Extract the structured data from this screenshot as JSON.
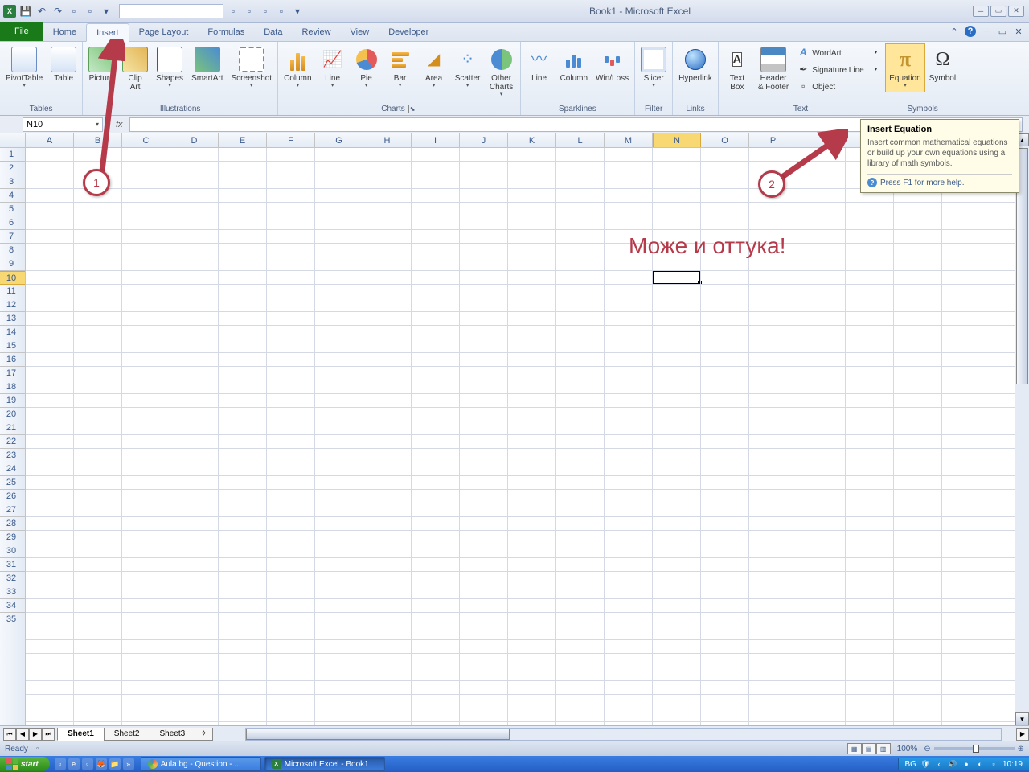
{
  "app_title": "Book1 - Microsoft Excel",
  "tabs": {
    "file": "File",
    "home": "Home",
    "insert": "Insert",
    "pagelayout": "Page Layout",
    "formulas": "Formulas",
    "data": "Data",
    "review": "Review",
    "view": "View",
    "developer": "Developer"
  },
  "ribbon": {
    "tables": {
      "label": "Tables",
      "pivottable": "PivotTable",
      "table": "Table"
    },
    "illustrations": {
      "label": "Illustrations",
      "picture": "Picture",
      "clipart": "Clip\nArt",
      "shapes": "Shapes",
      "smartart": "SmartArt",
      "screenshot": "Screenshot"
    },
    "charts": {
      "label": "Charts",
      "column": "Column",
      "line": "Line",
      "pie": "Pie",
      "bar": "Bar",
      "area": "Area",
      "scatter": "Scatter",
      "other": "Other\nCharts"
    },
    "sparklines": {
      "label": "Sparklines",
      "line": "Line",
      "column": "Column",
      "winloss": "Win/Loss"
    },
    "filter": {
      "label": "Filter",
      "slicer": "Slicer"
    },
    "links": {
      "label": "Links",
      "hyperlink": "Hyperlink"
    },
    "text": {
      "label": "Text",
      "textbox": "Text\nBox",
      "headerfooter": "Header\n& Footer",
      "wordart": "WordArt",
      "signature": "Signature Line",
      "object": "Object"
    },
    "symbols": {
      "label": "Symbols",
      "equation": "Equation",
      "symbol": "Symbol"
    }
  },
  "namebox": "N10",
  "columns": [
    "A",
    "B",
    "C",
    "D",
    "E",
    "F",
    "G",
    "H",
    "I",
    "J",
    "K",
    "L",
    "M",
    "N",
    "O",
    "P"
  ],
  "selected_col": "N",
  "selected_row": 10,
  "rows": 35,
  "sheets": {
    "s1": "Sheet1",
    "s2": "Sheet2",
    "s3": "Sheet3"
  },
  "status": "Ready",
  "zoom": "100%",
  "tooltip": {
    "title": "Insert Equation",
    "body": "Insert common mathematical equations or build up your own equations using a library of math symbols.",
    "help": "Press F1 for more help."
  },
  "annotation_text": "Може и оттука!",
  "taskbar": {
    "start": "start",
    "item1": "Aula.bg - Question - ...",
    "item2": "Microsoft Excel - Book1",
    "lang": "BG",
    "clock": "10:19"
  }
}
